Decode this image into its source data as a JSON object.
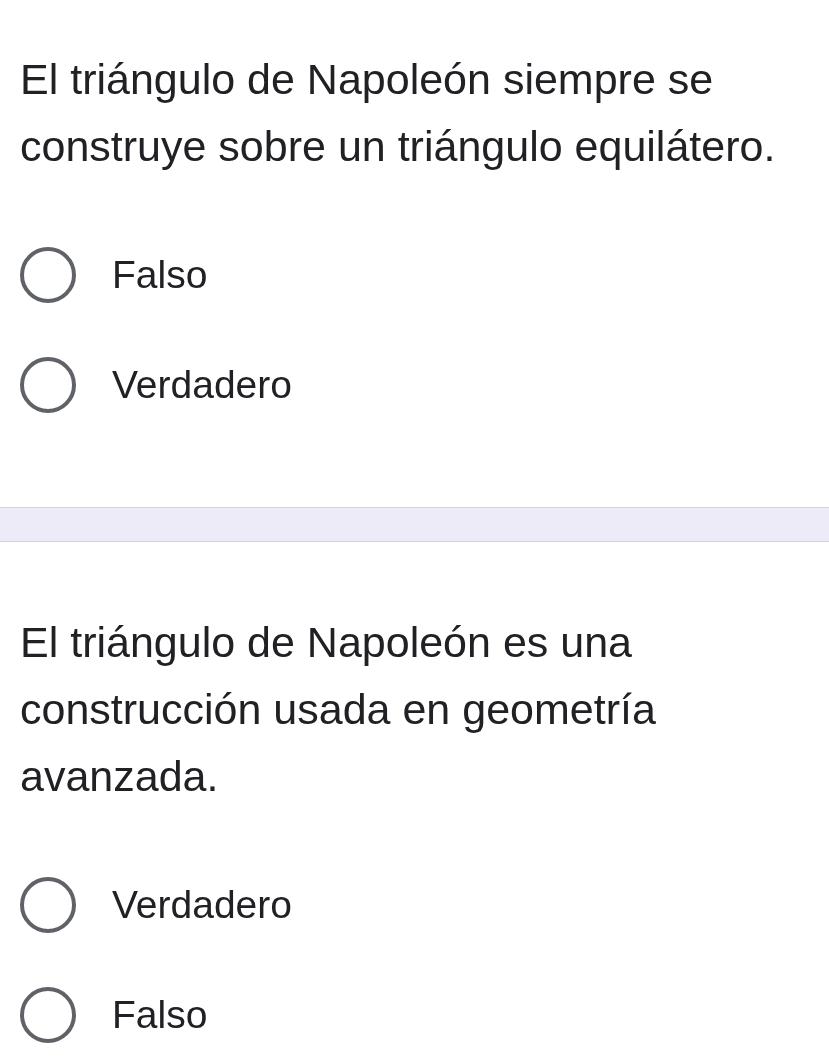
{
  "questions": [
    {
      "text": "El triángulo de Napoleón siempre se construye sobre un triángulo equilátero.",
      "options": [
        {
          "label": "Falso",
          "selected": false
        },
        {
          "label": "Verdadero",
          "selected": false
        }
      ]
    },
    {
      "text": "El triángulo de Napoleón es una construcción usada en geometría avanzada.",
      "options": [
        {
          "label": "Verdadero",
          "selected": false
        },
        {
          "label": "Falso",
          "selected": false
        }
      ]
    }
  ]
}
